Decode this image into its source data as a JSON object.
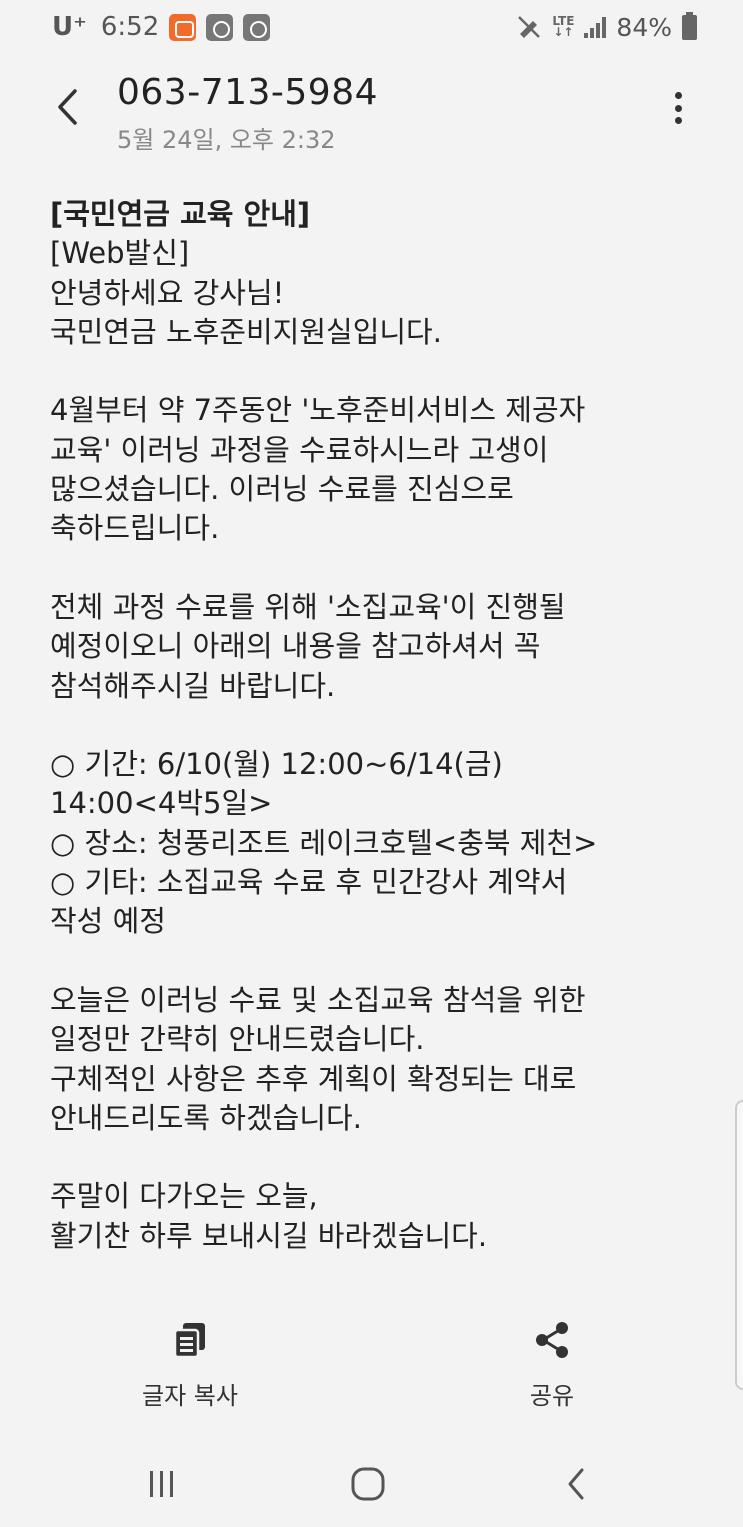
{
  "status_bar": {
    "carrier": "U⁺",
    "time": "6:52",
    "network": "LTE",
    "battery_percent": "84%"
  },
  "header": {
    "phone_number": "063-713-5984",
    "date": "5월 24일, 오후 2:32"
  },
  "message": {
    "title": "[국민연금 교육 안내]",
    "lines_1": "[Web발신]\n안녕하세요 강사님!\n국민연금 노후준비지원실입니다.",
    "para_2": "4월부터 약 7주동안 '노후준비서비스 제공자\n교육' 이러닝 과정을 수료하시느라 고생이\n많으셨습니다. 이러닝 수료를 진심으로\n축하드립니다.",
    "para_3": "전체 과정 수료를 위해 '소집교육'이 진행될\n예정이오니 아래의 내용을 참고하셔서 꼭\n참석해주시길 바랍니다.",
    "para_4": "○ 기간: 6/10(월) 12:00~6/14(금)\n14:00<4박5일>\n○ 장소: 청풍리조트 레이크호텔<충북 제천>\n○ 기타: 소집교육 수료 후 민간강사 계약서\n작성 예정",
    "para_5": "오늘은 이러닝 수료 및 소집교육 참석을 위한\n일정만 간략히 안내드렸습니다.\n구체적인 사항은 추후 계획이 확정되는 대로\n안내드리도록 하겠습니다.",
    "para_6": "주말이 다가오는 오늘,\n활기찬 하루 보내시길 바라겠습니다."
  },
  "actions": {
    "copy_label": "글자 복사",
    "share_label": "공유"
  },
  "icons": {
    "back": "chevron-left-icon",
    "more": "more-vertical-icon",
    "copy": "copy-text-icon",
    "share": "share-icon"
  },
  "colors": {
    "background": "#f3f3f3",
    "text": "#222222",
    "muted": "#888888",
    "notification_orange": "#f26b2a"
  }
}
